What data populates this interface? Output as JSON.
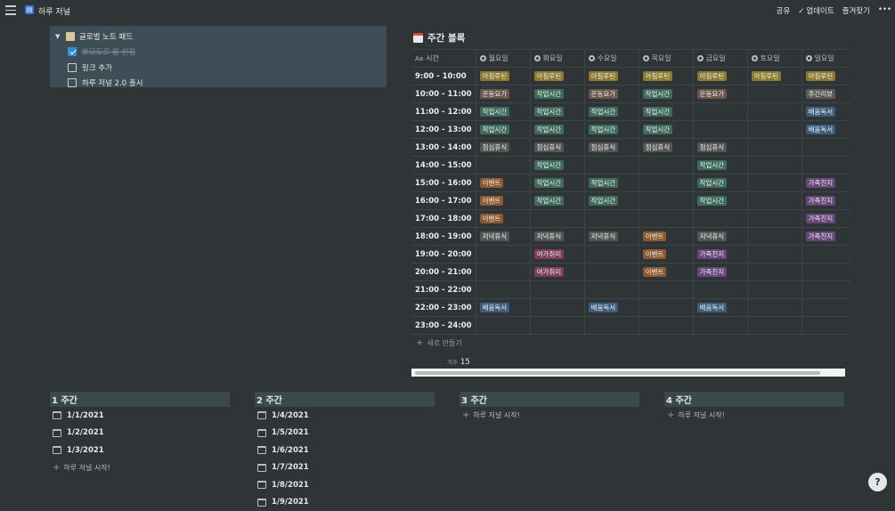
{
  "header": {
    "title": "하루 저널",
    "page_icon": "journal-icon",
    "share": "공유",
    "updates": "업데이트",
    "favorites": "즐겨찾기"
  },
  "callout": {
    "title": "글로벌 노트 패드",
    "todos": [
      {
        "label": "뽀모도로 팝 선점",
        "checked": true
      },
      {
        "label": "링크 추가",
        "checked": false
      },
      {
        "label": "하루 저널 2.0 출시",
        "checked": false
      }
    ]
  },
  "board": {
    "title": "주간 블록",
    "time_header": "시간",
    "days": [
      "월요일",
      "화요일",
      "수요일",
      "목요일",
      "금요일",
      "토요일",
      "일요일"
    ],
    "new_label": "새로 만들기",
    "count_label": "개수",
    "count_value": "15",
    "tag_colors": {
      "아침루틴": "#8a7a2e",
      "운동요가": "#6b554c",
      "작업시간": "#3e6b5b",
      "주간리뷰": "#5a5a5a",
      "배움독서": "#3d5d7d",
      "점심휴식": "#545454",
      "이벤트": "#8c5a2e",
      "가족친지": "#66477a",
      "저녁휴식": "#545454",
      "여가취미": "#7d3d5b"
    },
    "rows": [
      {
        "time": "9:00 - 10:00",
        "cells": [
          "아침루틴",
          "아침루틴",
          "아침루틴",
          "아침루틴",
          "아침루틴",
          "아침루틴",
          "아침루틴"
        ]
      },
      {
        "time": "10:00 - 11:00",
        "cells": [
          "운동요가",
          "작업시간",
          "운동요가",
          "작업시간",
          "운동요가",
          "",
          "주간리뷰"
        ]
      },
      {
        "time": "11:00 - 12:00",
        "cells": [
          "작업시간",
          "작업시간",
          "작업시간",
          "작업시간",
          "",
          "",
          "배움독서"
        ]
      },
      {
        "time": "12:00 - 13:00",
        "cells": [
          "작업시간",
          "작업시간",
          "작업시간",
          "작업시간",
          "",
          "",
          "배움독서"
        ]
      },
      {
        "time": "13:00 - 14:00",
        "cells": [
          "점심휴식",
          "점심휴식",
          "점심휴식",
          "점심휴식",
          "점심휴식",
          "",
          ""
        ]
      },
      {
        "time": "14:00 - 15:00",
        "cells": [
          "",
          "작업시간",
          "",
          "",
          "작업시간",
          "",
          ""
        ]
      },
      {
        "time": "15:00 - 16:00",
        "cells": [
          "이벤트",
          "작업시간",
          "작업시간",
          "",
          "작업시간",
          "",
          "가족친지"
        ]
      },
      {
        "time": "16:00 - 17:00",
        "cells": [
          "이벤트",
          "작업시간",
          "작업시간",
          "",
          "작업시간",
          "",
          "가족친지"
        ]
      },
      {
        "time": "17:00 - 18:00",
        "cells": [
          "이벤트",
          "",
          "",
          "",
          "",
          "",
          "가족친지"
        ]
      },
      {
        "time": "18:00 - 19:00",
        "cells": [
          "저녁휴식",
          "저녁휴식",
          "저녁휴식",
          "이벤트",
          "저녁휴식",
          "",
          "가족친지"
        ]
      },
      {
        "time": "19:00 - 20:00",
        "cells": [
          "",
          "여가취미",
          "",
          "이벤트",
          "가족친지",
          "",
          ""
        ]
      },
      {
        "time": "20:00 - 21:00",
        "cells": [
          "",
          "여가취미",
          "",
          "이벤트",
          "가족친지",
          "",
          ""
        ]
      },
      {
        "time": "21:00 - 22:00",
        "cells": [
          "",
          "",
          "",
          "",
          "",
          "",
          ""
        ]
      },
      {
        "time": "22:00 - 23:00",
        "cells": [
          "배움독서",
          "",
          "배움독서",
          "",
          "배움독서",
          "",
          ""
        ]
      },
      {
        "time": "23:00 - 24:00",
        "cells": [
          "",
          "",
          "",
          "",
          "",
          "",
          ""
        ]
      }
    ]
  },
  "weeks": [
    {
      "title": "1 주간",
      "entries": [
        "1/1/2021",
        "1/2/2021",
        "1/3/2021"
      ],
      "new_label": "하루 저널 시작!"
    },
    {
      "title": "2 주간",
      "entries": [
        "1/4/2021",
        "1/5/2021",
        "1/6/2021",
        "1/7/2021",
        "1/8/2021",
        "1/9/2021"
      ],
      "new_label": ""
    },
    {
      "title": "3 주간",
      "entries": [],
      "new_label": "하루 저널 시작!"
    },
    {
      "title": "4 주간",
      "entries": [],
      "new_label": "하루 저널 시작!"
    }
  ],
  "help_label": "?"
}
